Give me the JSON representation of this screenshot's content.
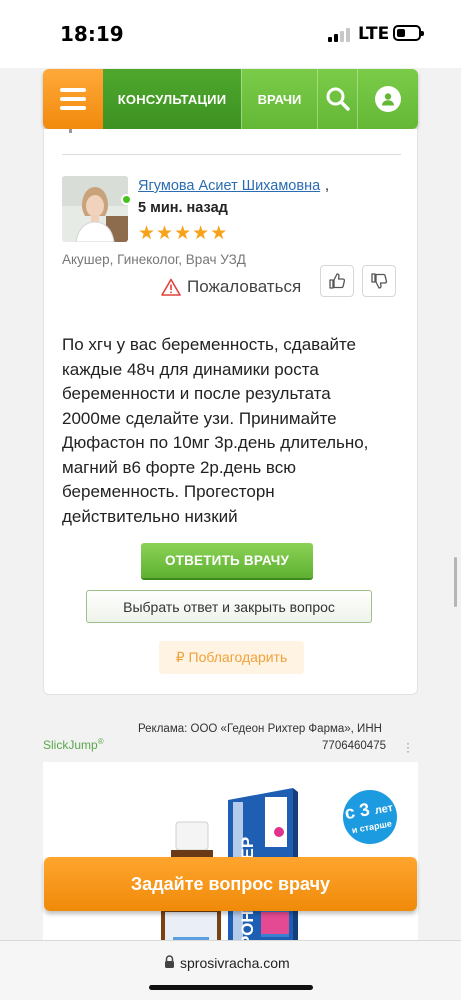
{
  "status_bar": {
    "time": "18:19",
    "network": "LTE",
    "signal_bars_on": 2,
    "signal_bars_total": 4
  },
  "nav": {
    "consultations": "КОНСУЛЬТАЦИИ",
    "doctors": "ВРАЧИ",
    "icons": {
      "menu": "menu-icon",
      "search": "search-icon",
      "user": "user-icon"
    },
    "colors": {
      "orange": "#f18a0c",
      "green_dark": "#3d9122",
      "green": "#64b836"
    }
  },
  "answer_card": {
    "doctor_name": "Ягумова Асиет Шихамовна",
    "name_suffix": ",",
    "time_ago": "5 мин. назад",
    "rating_stars": 5,
    "specialty": "Акушер, Гинеколог, Врач УЗД",
    "complain_label": "Пожаловаться",
    "answer_text": "По хгч у вас беременность, сдавайте каждые 48ч для динамики роста беременности и после результата 2000ме сделайте узи. Принимайте Дюфастон по 10мг 3р.день длительно, магний в6 форте 2р.день всю беременность. Прогесторн действительно низкий",
    "reply_button": "ОТВЕТИТЬ ВРАЧУ",
    "close_button": "Выбрать ответ и закрыть вопрос",
    "thank_button": "₽ Поблагодарить"
  },
  "ad": {
    "disclaimer_line1": "Реклама: ООО «Гедеон Рихтер Фарма», ИНН",
    "disclaimer_line2": "7706460475",
    "network_label": "SlickJump",
    "network_mark": "®",
    "badge_prefix": "с",
    "badge_number": "3",
    "badge_suffix": "лет",
    "badge_line2": "и старше",
    "product_brand_text": "РОН-РИХТЕР"
  },
  "ask_button": "Задайте вопрос врачу",
  "url_bar": {
    "domain": "sprosivracha.com"
  }
}
